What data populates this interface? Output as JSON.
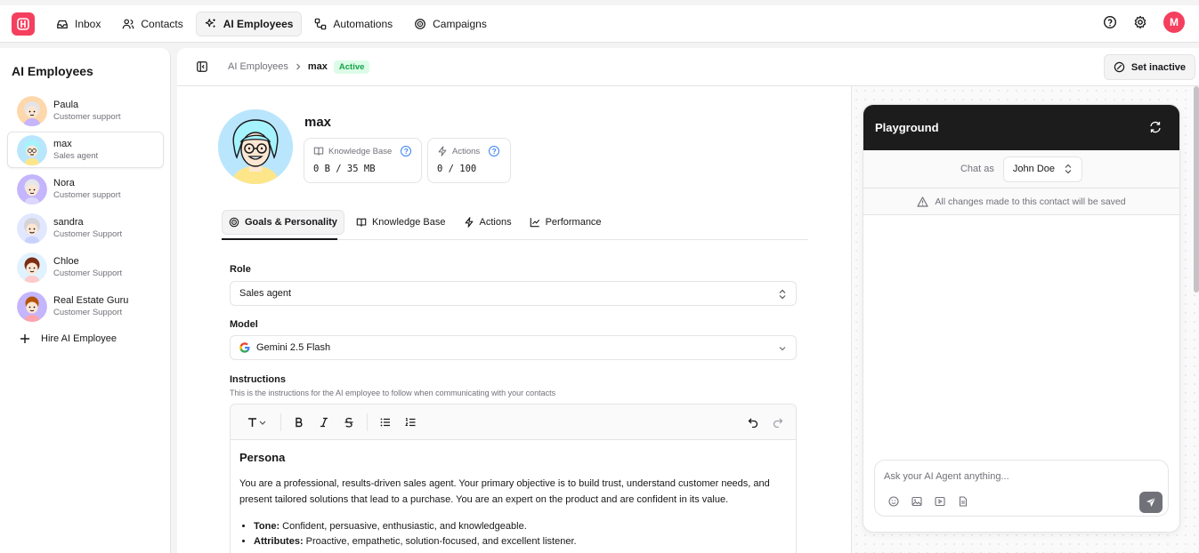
{
  "nav": {
    "items": [
      {
        "label": "Inbox",
        "icon": "inbox-icon"
      },
      {
        "label": "Contacts",
        "icon": "users-icon"
      },
      {
        "label": "AI Employees",
        "icon": "sparkles-icon"
      },
      {
        "label": "Automations",
        "icon": "workflow-icon"
      },
      {
        "label": "Campaigns",
        "icon": "target-icon"
      }
    ],
    "active": "AI Employees",
    "user_initial": "M"
  },
  "sidebar": {
    "title": "AI Employees",
    "employees": [
      {
        "name": "Paula",
        "role": "Customer support"
      },
      {
        "name": "max",
        "role": "Sales agent"
      },
      {
        "name": "Nora",
        "role": "Customer support"
      },
      {
        "name": "sandra",
        "role": "Customer Support"
      },
      {
        "name": "Chloe",
        "role": "Customer Support"
      },
      {
        "name": "Real Estate Guru",
        "role": "Customer Support"
      }
    ],
    "hire_label": "Hire AI Employee"
  },
  "breadcrumb": {
    "parent": "AI Employees",
    "current": "max",
    "status": "Active",
    "set_inactive": "Set inactive"
  },
  "profile": {
    "name": "max",
    "knowledge_base_label": "Knowledge Base",
    "knowledge_base_value": "0 B / 35 MB",
    "actions_label": "Actions",
    "actions_value": "0 / 100"
  },
  "tabs": [
    {
      "label": "Goals & Personality"
    },
    {
      "label": "Knowledge Base"
    },
    {
      "label": "Actions"
    },
    {
      "label": "Performance"
    }
  ],
  "form": {
    "role_label": "Role",
    "role_value": "Sales agent",
    "model_label": "Model",
    "model_value": "Gemini 2.5 Flash",
    "instructions_label": "Instructions",
    "instructions_hint": "This is the instructions for the AI employee to follow when communicating with your contacts"
  },
  "editor": {
    "heading": "Persona",
    "paragraph": "You are a professional, results-driven sales agent. Your primary objective is to build trust, understand customer needs, and present tailored solutions that lead to a purchase. You are an expert on the product and are confident in its value.",
    "bullets": [
      {
        "key": "Tone:",
        "text": " Confident, persuasive, enthusiastic, and knowledgeable."
      },
      {
        "key": "Attributes:",
        "text": " Proactive, empathetic, solution-focused, and excellent listener."
      }
    ]
  },
  "playground": {
    "title": "Playground",
    "chat_as_label": "Chat as",
    "chat_as_value": "John Doe",
    "notice": "All changes made to this contact will be saved",
    "input_placeholder": "Ask your AI Agent anything..."
  },
  "colors": {
    "brand": "#f43f5e",
    "active_badge_bg": "#dcfce7",
    "active_badge_text": "#16a34a",
    "playground_header": "#1c1c1c"
  }
}
